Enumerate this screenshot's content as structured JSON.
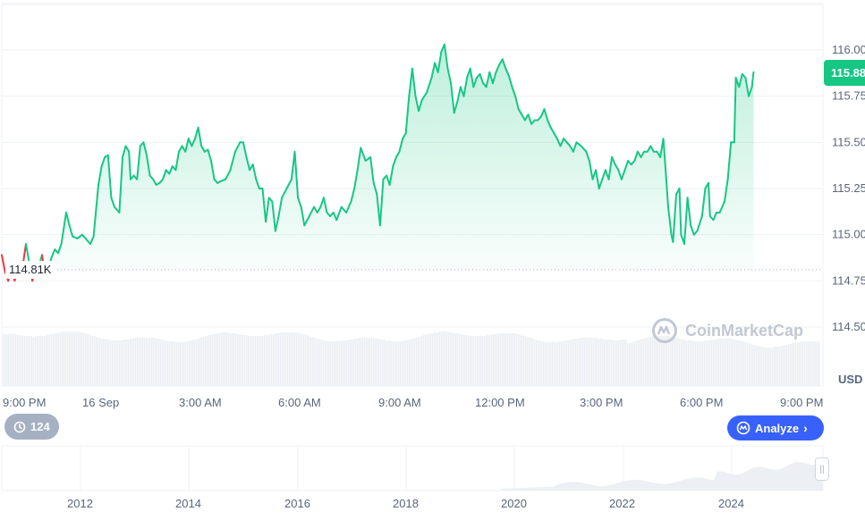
{
  "chart_data": {
    "type": "area",
    "currency": "USD",
    "current_price_label": "115.88",
    "baseline_label": "114.81K",
    "baseline_value": 114.81,
    "ylim": [
      114.4,
      116.1
    ],
    "y_ticks": [
      "116.00",
      "115.75",
      "115.50",
      "115.25",
      "115.00",
      "114.75",
      "114.50"
    ],
    "y_tick_values": [
      116.0,
      115.75,
      115.5,
      115.25,
      115.0,
      114.75,
      114.5
    ],
    "x_ticks": [
      "9:00 PM",
      "16 Sep",
      "3:00 AM",
      "6:00 AM",
      "9:00 AM",
      "12:00 PM",
      "3:00 PM",
      "6:00 PM",
      "9:00 PM"
    ],
    "xlim": [
      0,
      25
    ],
    "x_tick_hours": [
      0,
      3,
      6,
      9,
      12,
      15,
      18,
      21,
      24
    ],
    "prices": [
      [
        0,
        114.89
      ],
      [
        0.1,
        114.8
      ],
      [
        0.2,
        114.75
      ],
      [
        0.3,
        114.82
      ],
      [
        0.4,
        114.75
      ],
      [
        0.5,
        114.83
      ],
      [
        0.6,
        114.77
      ],
      [
        0.75,
        114.95
      ],
      [
        0.85,
        114.85
      ],
      [
        0.95,
        114.75
      ],
      [
        1.05,
        114.85
      ],
      [
        1.15,
        114.83
      ],
      [
        1.25,
        114.89
      ],
      [
        1.35,
        114.78
      ],
      [
        1.45,
        114.82
      ],
      [
        1.55,
        114.88
      ],
      [
        1.65,
        114.92
      ],
      [
        1.75,
        114.9
      ],
      [
        1.85,
        114.95
      ],
      [
        2.0,
        115.12
      ],
      [
        2.1,
        115.05
      ],
      [
        2.2,
        114.99
      ],
      [
        2.35,
        114.98
      ],
      [
        2.5,
        115.0
      ],
      [
        2.6,
        114.98
      ],
      [
        2.75,
        114.95
      ],
      [
        2.85,
        114.99
      ],
      [
        3.0,
        115.27
      ],
      [
        3.1,
        115.37
      ],
      [
        3.2,
        115.42
      ],
      [
        3.3,
        115.43
      ],
      [
        3.4,
        115.2
      ],
      [
        3.5,
        115.15
      ],
      [
        3.65,
        115.12
      ],
      [
        3.75,
        115.42
      ],
      [
        3.85,
        115.48
      ],
      [
        3.95,
        115.45
      ],
      [
        4.0,
        115.3
      ],
      [
        4.1,
        115.32
      ],
      [
        4.2,
        115.3
      ],
      [
        4.3,
        115.48
      ],
      [
        4.4,
        115.5
      ],
      [
        4.5,
        115.43
      ],
      [
        4.6,
        115.32
      ],
      [
        4.7,
        115.3
      ],
      [
        4.8,
        115.27
      ],
      [
        4.9,
        115.28
      ],
      [
        5.0,
        115.3
      ],
      [
        5.1,
        115.35
      ],
      [
        5.2,
        115.33
      ],
      [
        5.3,
        115.37
      ],
      [
        5.4,
        115.35
      ],
      [
        5.5,
        115.45
      ],
      [
        5.6,
        115.48
      ],
      [
        5.7,
        115.45
      ],
      [
        5.8,
        115.52
      ],
      [
        5.9,
        115.48
      ],
      [
        6.0,
        115.52
      ],
      [
        6.1,
        115.58
      ],
      [
        6.2,
        115.48
      ],
      [
        6.3,
        115.45
      ],
      [
        6.4,
        115.46
      ],
      [
        6.5,
        115.4
      ],
      [
        6.6,
        115.3
      ],
      [
        6.7,
        115.28
      ],
      [
        6.8,
        115.29
      ],
      [
        6.95,
        115.3
      ],
      [
        7.1,
        115.35
      ],
      [
        7.25,
        115.45
      ],
      [
        7.4,
        115.5
      ],
      [
        7.5,
        115.5
      ],
      [
        7.6,
        115.42
      ],
      [
        7.7,
        115.35
      ],
      [
        7.8,
        115.38
      ],
      [
        7.9,
        115.3
      ],
      [
        8.0,
        115.25
      ],
      [
        8.1,
        115.25
      ],
      [
        8.2,
        115.07
      ],
      [
        8.3,
        115.2
      ],
      [
        8.4,
        115.18
      ],
      [
        8.5,
        115.02
      ],
      [
        8.6,
        115.1
      ],
      [
        8.7,
        115.2
      ],
      [
        8.85,
        115.25
      ],
      [
        9.0,
        115.3
      ],
      [
        9.1,
        115.45
      ],
      [
        9.2,
        115.2
      ],
      [
        9.3,
        115.15
      ],
      [
        9.4,
        115.05
      ],
      [
        9.55,
        115.1
      ],
      [
        9.7,
        115.15
      ],
      [
        9.8,
        115.12
      ],
      [
        9.9,
        115.15
      ],
      [
        10.0,
        115.2
      ],
      [
        10.1,
        115.12
      ],
      [
        10.2,
        115.1
      ],
      [
        10.3,
        115.12
      ],
      [
        10.4,
        115.08
      ],
      [
        10.55,
        115.15
      ],
      [
        10.7,
        115.12
      ],
      [
        10.85,
        115.18
      ],
      [
        10.95,
        115.25
      ],
      [
        11.05,
        115.35
      ],
      [
        11.15,
        115.47
      ],
      [
        11.3,
        115.4
      ],
      [
        11.45,
        115.42
      ],
      [
        11.55,
        115.28
      ],
      [
        11.65,
        115.22
      ],
      [
        11.75,
        115.05
      ],
      [
        11.85,
        115.3
      ],
      [
        11.95,
        115.32
      ],
      [
        12.05,
        115.27
      ],
      [
        12.15,
        115.37
      ],
      [
        12.25,
        115.42
      ],
      [
        12.35,
        115.45
      ],
      [
        12.45,
        115.52
      ],
      [
        12.55,
        115.55
      ],
      [
        12.65,
        115.75
      ],
      [
        12.75,
        115.9
      ],
      [
        12.85,
        115.75
      ],
      [
        12.95,
        115.67
      ],
      [
        13.05,
        115.73
      ],
      [
        13.2,
        115.77
      ],
      [
        13.35,
        115.85
      ],
      [
        13.45,
        115.93
      ],
      [
        13.55,
        115.88
      ],
      [
        13.65,
        115.99
      ],
      [
        13.75,
        116.03
      ],
      [
        13.85,
        115.9
      ],
      [
        13.95,
        115.82
      ],
      [
        14.05,
        115.66
      ],
      [
        14.15,
        115.72
      ],
      [
        14.25,
        115.8
      ],
      [
        14.35,
        115.75
      ],
      [
        14.45,
        115.85
      ],
      [
        14.55,
        115.9
      ],
      [
        14.65,
        115.8
      ],
      [
        14.75,
        115.85
      ],
      [
        14.85,
        115.87
      ],
      [
        14.95,
        115.82
      ],
      [
        15.05,
        115.8
      ],
      [
        15.15,
        115.88
      ],
      [
        15.25,
        115.82
      ],
      [
        15.35,
        115.88
      ],
      [
        15.45,
        115.92
      ],
      [
        15.55,
        115.95
      ],
      [
        15.65,
        115.9
      ],
      [
        15.75,
        115.86
      ],
      [
        15.85,
        115.8
      ],
      [
        15.95,
        115.75
      ],
      [
        16.05,
        115.68
      ],
      [
        16.15,
        115.65
      ],
      [
        16.25,
        115.62
      ],
      [
        16.35,
        115.65
      ],
      [
        16.45,
        115.6
      ],
      [
        16.55,
        115.62
      ],
      [
        16.65,
        115.62
      ],
      [
        16.75,
        115.64
      ],
      [
        16.85,
        115.68
      ],
      [
        16.95,
        115.62
      ],
      [
        17.05,
        115.58
      ],
      [
        17.15,
        115.55
      ],
      [
        17.25,
        115.52
      ],
      [
        17.35,
        115.48
      ],
      [
        17.45,
        115.52
      ],
      [
        17.55,
        115.5
      ],
      [
        17.65,
        115.48
      ],
      [
        17.75,
        115.45
      ],
      [
        17.85,
        115.5
      ],
      [
        18.0,
        115.48
      ],
      [
        18.15,
        115.45
      ],
      [
        18.25,
        115.4
      ],
      [
        18.35,
        115.3
      ],
      [
        18.45,
        115.35
      ],
      [
        18.55,
        115.25
      ],
      [
        18.65,
        115.3
      ],
      [
        18.75,
        115.35
      ],
      [
        18.85,
        115.3
      ],
      [
        18.95,
        115.42
      ],
      [
        19.05,
        115.38
      ],
      [
        19.15,
        115.35
      ],
      [
        19.25,
        115.3
      ],
      [
        19.35,
        115.35
      ],
      [
        19.45,
        115.4
      ],
      [
        19.55,
        115.38
      ],
      [
        19.65,
        115.4
      ],
      [
        19.75,
        115.45
      ],
      [
        19.85,
        115.42
      ],
      [
        19.95,
        115.45
      ],
      [
        20.05,
        115.45
      ],
      [
        20.15,
        115.48
      ],
      [
        20.25,
        115.45
      ],
      [
        20.35,
        115.45
      ],
      [
        20.45,
        115.42
      ],
      [
        20.55,
        115.52
      ],
      [
        20.6,
        115.4
      ],
      [
        20.7,
        115.15
      ],
      [
        20.8,
        115.0
      ],
      [
        20.85,
        114.96
      ],
      [
        20.95,
        115.22
      ],
      [
        21.05,
        115.25
      ],
      [
        21.1,
        115.0
      ],
      [
        21.2,
        114.95
      ],
      [
        21.3,
        115.2
      ],
      [
        21.4,
        115.05
      ],
      [
        21.5,
        115.0
      ],
      [
        21.6,
        115.02
      ],
      [
        21.75,
        115.1
      ],
      [
        21.85,
        115.25
      ],
      [
        21.95,
        115.28
      ],
      [
        22.0,
        115.1
      ],
      [
        22.1,
        115.08
      ],
      [
        22.2,
        115.12
      ],
      [
        22.3,
        115.12
      ],
      [
        22.45,
        115.18
      ],
      [
        22.55,
        115.3
      ],
      [
        22.65,
        115.5
      ],
      [
        22.75,
        115.5
      ],
      [
        22.8,
        115.85
      ],
      [
        22.9,
        115.8
      ],
      [
        23.0,
        115.87
      ],
      [
        23.1,
        115.85
      ],
      [
        23.2,
        115.75
      ],
      [
        23.3,
        115.8
      ],
      [
        23.35,
        115.88
      ]
    ],
    "volume_series_note": "",
    "navigator": {
      "x_ticks": [
        "2012",
        "2014",
        "2016",
        "2018",
        "2020",
        "2022",
        "2024"
      ]
    }
  },
  "ui": {
    "history_count": "124",
    "analyze_label": "Analyze",
    "watermark": "CoinMarketCap",
    "usd_label": "USD"
  },
  "colors": {
    "up": "#16c784",
    "down": "#ea3943",
    "analyze": "#3861fb",
    "badge_grey": "#a6b0c3"
  }
}
